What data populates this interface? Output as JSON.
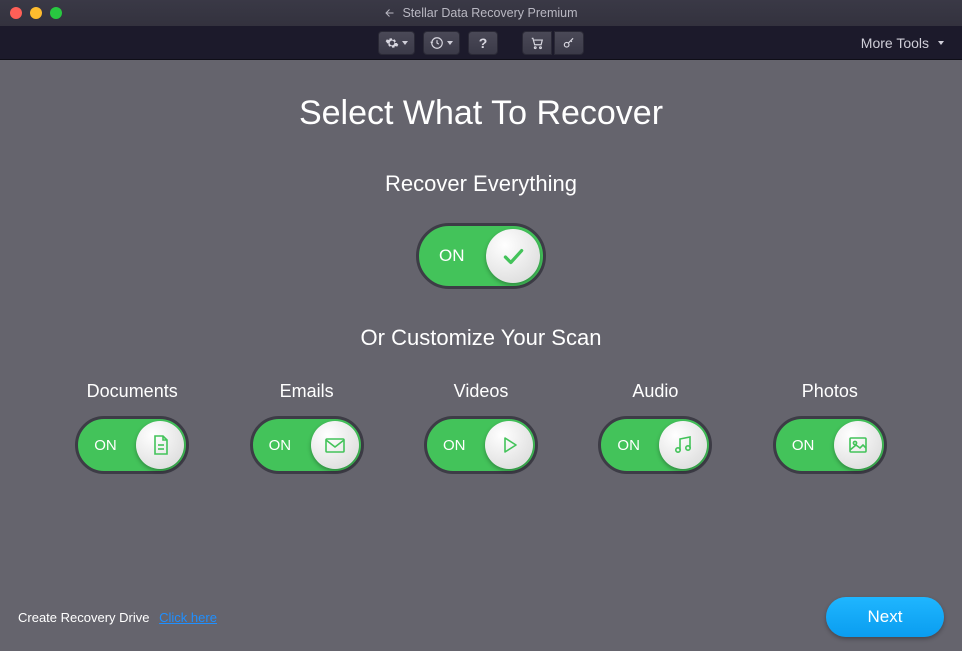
{
  "window": {
    "title": "Stellar Data Recovery Premium"
  },
  "toolbar": {
    "more_tools": "More Tools"
  },
  "main": {
    "heading": "Select What To Recover",
    "recover_everything_label": "Recover Everything",
    "customize_label": "Or Customize Your Scan",
    "toggle_on": "ON"
  },
  "categories": [
    {
      "label": "Documents",
      "state": "ON",
      "icon": "document"
    },
    {
      "label": "Emails",
      "state": "ON",
      "icon": "email"
    },
    {
      "label": "Videos",
      "state": "ON",
      "icon": "video"
    },
    {
      "label": "Audio",
      "state": "ON",
      "icon": "audio"
    },
    {
      "label": "Photos",
      "state": "ON",
      "icon": "photo"
    }
  ],
  "footer": {
    "create_recovery": "Create Recovery Drive",
    "click_here": "Click here",
    "next": "Next"
  }
}
